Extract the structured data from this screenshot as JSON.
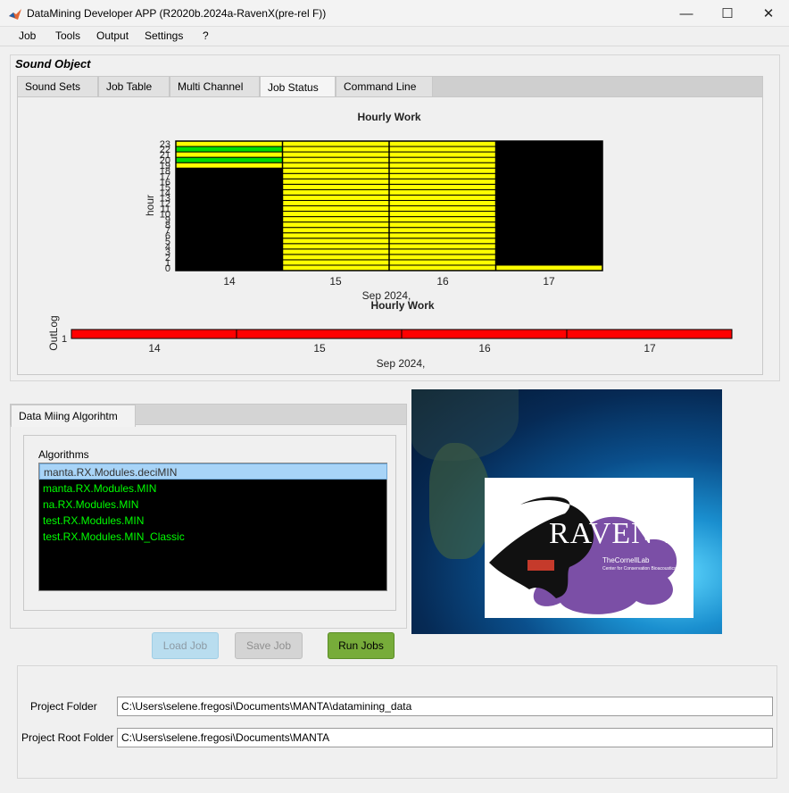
{
  "window": {
    "title": "DataMining Developer APP (R2020b.2024a-RavenX(pre-rel F))",
    "minimize_glyph": "—",
    "maximize_glyph": "☐",
    "close_glyph": "✕"
  },
  "menu": [
    "Job",
    "Tools",
    "Output",
    "Settings",
    "?"
  ],
  "sound_panel": {
    "title": "Sound Object",
    "tabs": [
      "Sound Sets",
      "Job Table",
      "Multi Channel",
      "Job Status",
      "Command Line"
    ],
    "active_tab": "Job Status"
  },
  "chart_data": [
    {
      "type": "heatmap",
      "title": "Hourly Work",
      "ylabel": "hour",
      "xlabel": "Sep 2024,",
      "x_ticks": [
        "14",
        "15",
        "16",
        "17"
      ],
      "y_ticks": [
        "0",
        "1",
        "2",
        "3",
        "4",
        "5",
        "6",
        "7",
        "8",
        "9",
        "10",
        "11",
        "12",
        "13",
        "14",
        "15",
        "16",
        "17",
        "18",
        "19",
        "20",
        "21",
        "22",
        "23"
      ],
      "days": [
        14,
        15,
        16,
        17
      ],
      "hours": [
        0,
        23
      ],
      "colors": {
        "none": "#000000",
        "pending": "#ffff00",
        "done": "#00dd00"
      },
      "status": {
        "14": {
          "pending": [
            19,
            21,
            23
          ],
          "done": [
            20,
            22
          ],
          "none_other": true
        },
        "15": {
          "pending": "all"
        },
        "16": {
          "pending": "all"
        },
        "17": {
          "pending": [
            0
          ]
        }
      }
    },
    {
      "type": "heatmap",
      "title": "Hourly Work",
      "ylabel": "OutLog",
      "xlabel": "Sep 2024,",
      "x_ticks": [
        "14",
        "15",
        "16",
        "17"
      ],
      "y_ticks": [
        "1"
      ],
      "color": "#ff0000"
    }
  ],
  "algorithm_panel": {
    "tab": "Data Miing Algorihtm",
    "list_label": "Algorithms",
    "items": [
      "manta.RX.Modules.deciMIN",
      "manta.RX.Modules.MIN",
      "na.RX.Modules.MIN",
      "test.RX.Modules.MIN",
      "test.RX.Modules.MIN_Classic"
    ],
    "selected_index": 0
  },
  "logo": {
    "brand": "RAVEN-X",
    "org": "TheCornellLab",
    "sub": "Center for Conservation Bioacoustics"
  },
  "buttons": {
    "load": "Load Job",
    "save": "Save Job",
    "run": "Run Jobs"
  },
  "folders": {
    "project_label": "Project Folder",
    "project_value": "C:\\Users\\selene.fregosi\\Documents\\MANTA\\datamining_data",
    "root_label": "Project Root Folder",
    "root_value": "C:\\Users\\selene.fregosi\\Documents\\MANTA"
  }
}
